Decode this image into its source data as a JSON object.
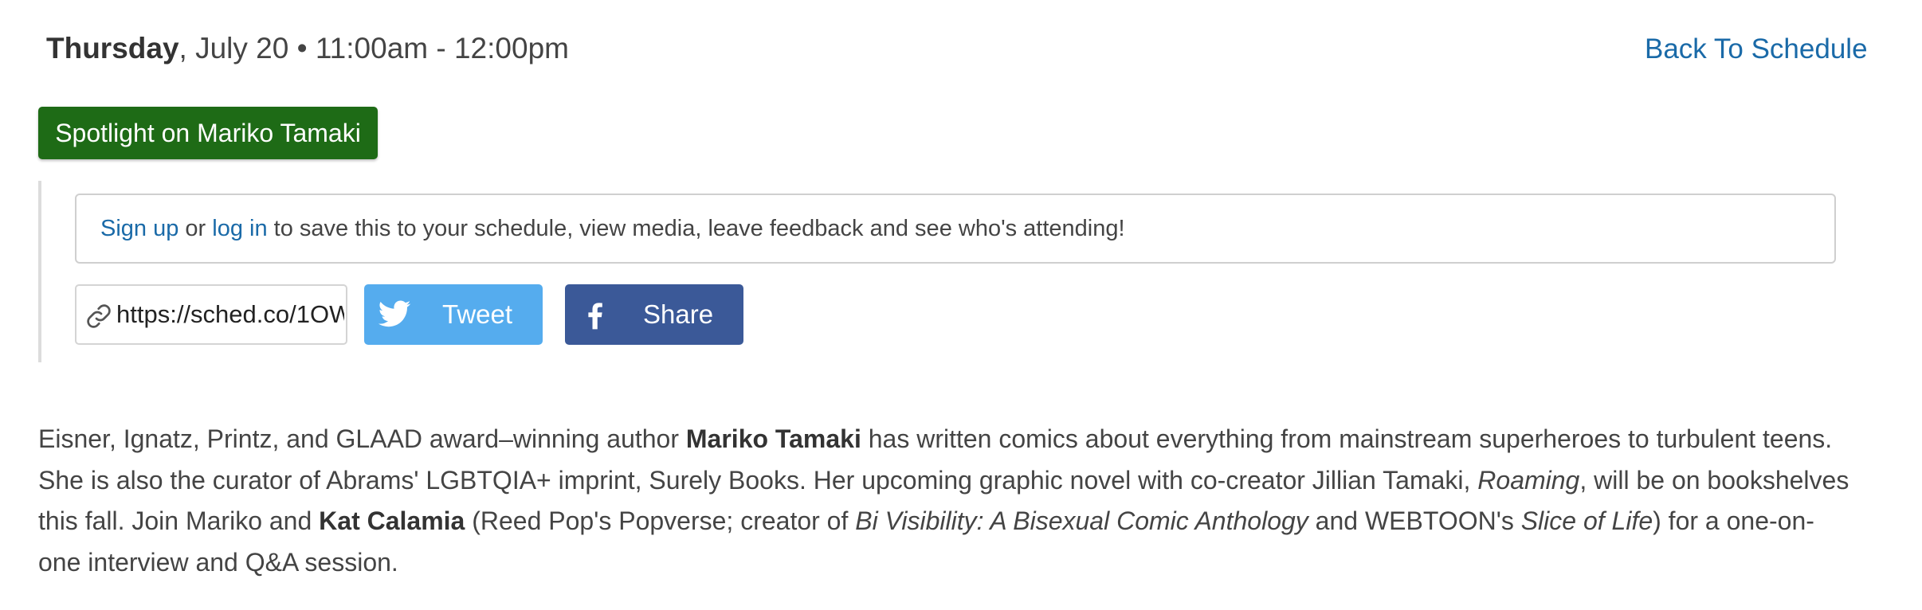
{
  "event": {
    "day": "Thursday",
    "date_time": ", July 20 • 11:00am - 12:00pm",
    "back_link": "Back To Schedule",
    "tag": "Spotlight on Mariko Tamaki"
  },
  "signup_bar": {
    "signup_link": "Sign up",
    "or": " or ",
    "login_link": "log in",
    "rest": " to save this to your schedule, view media, leave feedback and see who's attending!"
  },
  "share": {
    "url_value": "https://sched.co/1OW",
    "tweet_label": "Tweet",
    "share_label": "Share",
    "icons": {
      "link": "link-icon",
      "twitter": "twitter-bird-icon",
      "facebook": "facebook-f-icon"
    },
    "colors": {
      "tweet": "#55acee",
      "share": "#3b5998",
      "tag": "#1e6b16",
      "link": "#1a6aa8"
    }
  },
  "description": {
    "p1": "Eisner, Ignatz, Printz, and GLAAD award–winning author ",
    "b1": "Mariko Tamaki",
    "p2": " has written comics about everything from mainstream superheroes to turbulent teens. She is also the curator of Abrams' LGBTQIA+ imprint, Surely Books. Her upcoming graphic novel with co-creator Jillian Tamaki, ",
    "i1": "Roaming",
    "p3": ", will be on bookshelves this fall. Join Mariko and ",
    "b2": "Kat Calamia",
    "p4": " (Reed Pop's Popverse; creator of ",
    "i2": "Bi Visibility: A Bisexual Comic Anthology",
    "p5": " and WEBTOON's ",
    "i3": "Slice of Life",
    "p6": ") for a one-on-one interview and Q&A session."
  }
}
